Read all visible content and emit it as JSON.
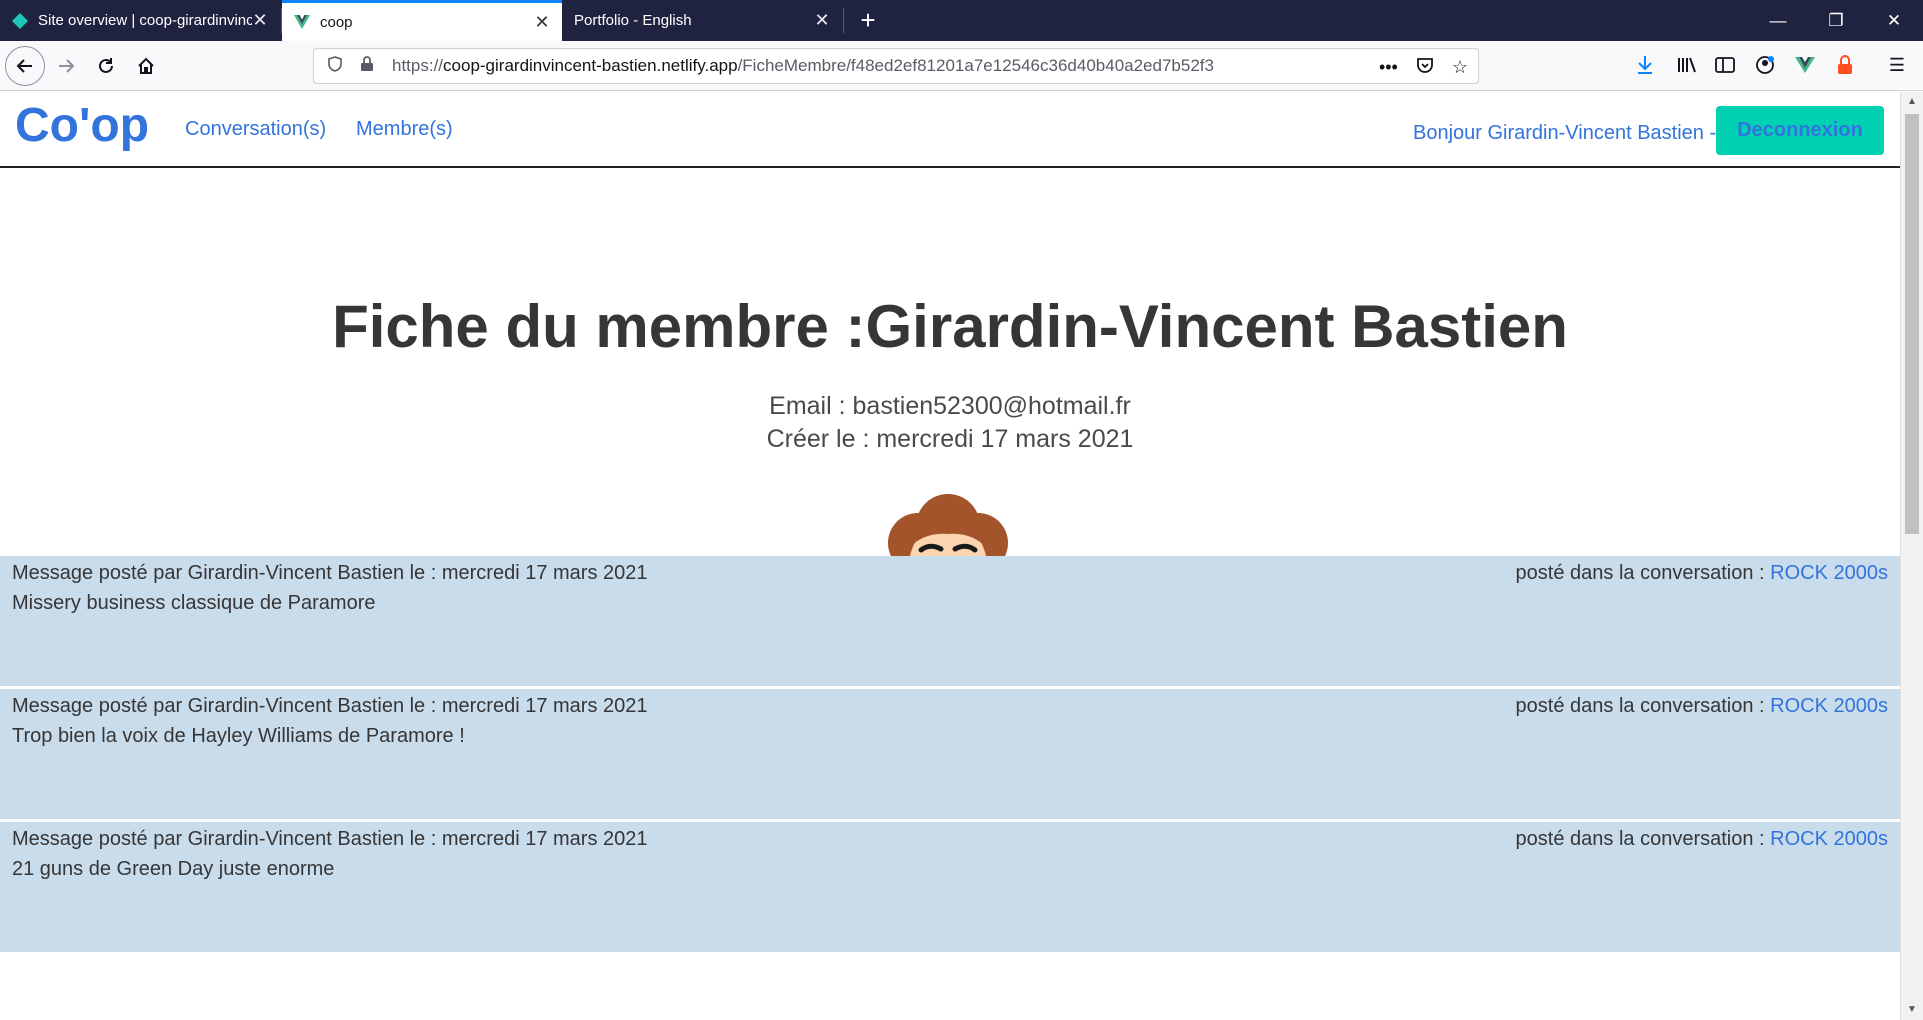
{
  "browser": {
    "tabs": [
      {
        "title": "Site overview | coop-girardinvincent-bastien",
        "active": false
      },
      {
        "title": "coop",
        "active": true
      },
      {
        "title": "Portfolio - English",
        "active": false
      }
    ],
    "url_scheme": "https://",
    "url_host": "coop-girardinvincent-bastien.netlify.app",
    "url_path": "/FicheMembre/f48ed2ef81201a7e12546c36d40b40a2ed7b52f3",
    "accent_color": "#0a84ff"
  },
  "site": {
    "brand": "Co'op",
    "nav": {
      "conversations": "Conversation(s)",
      "members": "Membre(s)"
    },
    "greeting": "Bonjour Girardin-Vincent Bastien -",
    "logout_label": "Deconnexion",
    "colors": {
      "link": "#3273dc",
      "button": "#00d1b2",
      "message_bg": "#c9dcec"
    }
  },
  "profile": {
    "title": "Fiche du membre :Girardin-Vincent Bastien",
    "email_line": "Email : bastien52300@hotmail.fr",
    "created_line": "Créer le : mercredi 17 mars 2021",
    "avatar_icon": "avatar-illustration"
  },
  "messages": [
    {
      "meta": "Message posté par Girardin-Vincent Bastien le : mercredi 17 mars 2021",
      "conv_prefix": "posté dans la conversation : ",
      "conv_link": "ROCK 2000s",
      "body": "Missery business classique de Paramore"
    },
    {
      "meta": "Message posté par Girardin-Vincent Bastien le : mercredi 17 mars 2021",
      "conv_prefix": "posté dans la conversation : ",
      "conv_link": "ROCK 2000s",
      "body": "Trop bien la voix de Hayley Williams de Paramore !"
    },
    {
      "meta": "Message posté par Girardin-Vincent Bastien le : mercredi 17 mars 2021",
      "conv_prefix": "posté dans la conversation : ",
      "conv_link": "ROCK 2000s",
      "body": "21 guns de Green Day juste enorme"
    }
  ]
}
